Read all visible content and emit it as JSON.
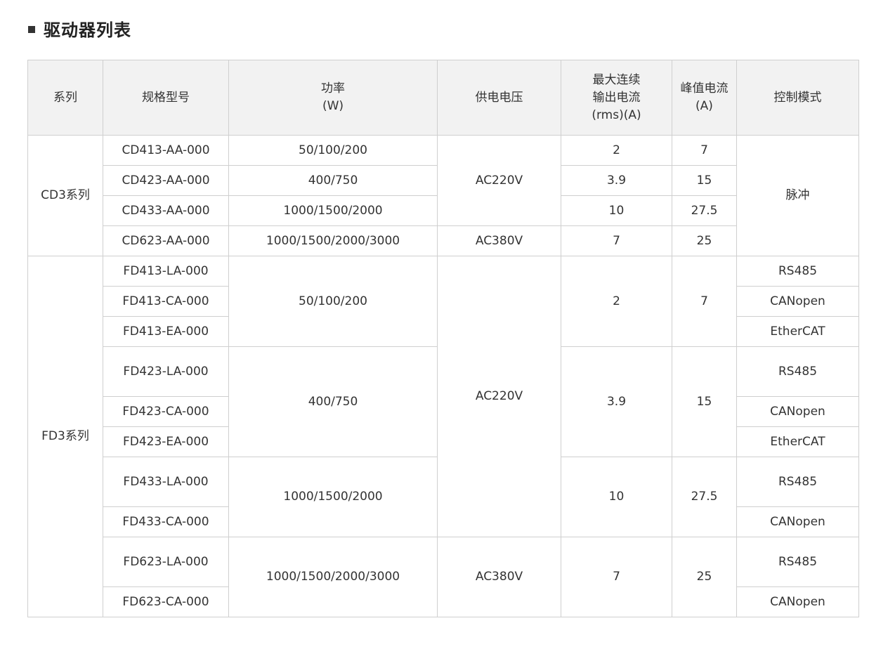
{
  "page_title": "驱动器列表",
  "headers": {
    "series": "系列",
    "model": "规格型号",
    "power": [
      "功率",
      "(W)"
    ],
    "voltage": "供电电压",
    "continuous_current": [
      "最大连续",
      "输出电流",
      "(rms)(A)"
    ],
    "peak_current": [
      "峰值电流",
      "(A)"
    ],
    "control_mode": "控制模式"
  },
  "cd3": {
    "series": "CD3系列",
    "models": [
      "CD413-AA-000",
      "CD423-AA-000",
      "CD433-AA-000",
      "CD623-AA-000"
    ],
    "power": [
      "50/100/200",
      "400/750",
      "1000/1500/2000",
      "1000/1500/2000/3000"
    ],
    "voltage": [
      "AC220V",
      "AC380V"
    ],
    "continuous_current": [
      "2",
      "3.9",
      "10",
      "7"
    ],
    "peak_current": [
      "7",
      "15",
      "27.5",
      "25"
    ],
    "control_mode": "脉冲"
  },
  "fd3": {
    "series": "FD3系列",
    "models": [
      "FD413-LA-000",
      "FD413-CA-000",
      "FD413-EA-000",
      "FD423-LA-000",
      "FD423-CA-000",
      "FD423-EA-000",
      "FD433-LA-000",
      "FD433-CA-000",
      "FD623-LA-000",
      "FD623-CA-000"
    ],
    "power": [
      "50/100/200",
      "400/750",
      "1000/1500/2000",
      "1000/1500/2000/3000"
    ],
    "voltage": [
      "AC220V",
      "AC380V"
    ],
    "continuous_current": [
      "2",
      "3.9",
      "10",
      "7"
    ],
    "peak_current": [
      "7",
      "15",
      "27.5",
      "25"
    ],
    "control_modes": [
      "RS485",
      "CANopen",
      "EtherCAT",
      "RS485",
      "CANopen",
      "EtherCAT",
      "RS485",
      "CANopen",
      "RS485",
      "CANopen"
    ]
  }
}
